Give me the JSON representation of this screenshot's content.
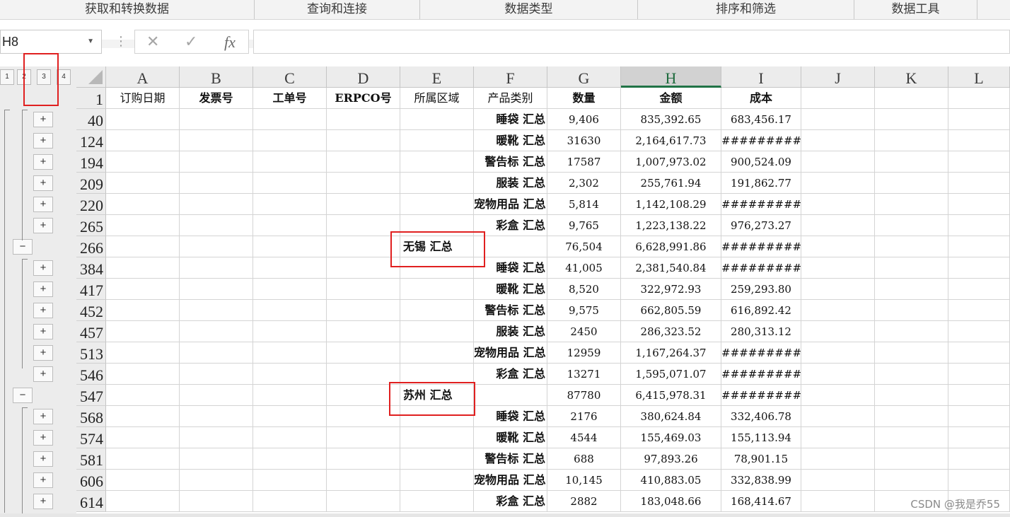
{
  "ribbon": {
    "groups": [
      "获取和转换数据",
      "查询和连接",
      "数据类型",
      "排序和筛选",
      "数据工具"
    ]
  },
  "formula_bar": {
    "name_box": "H8",
    "cancel_icon": "✕",
    "enter_icon": "✓",
    "fx_label": "fx",
    "formula": ""
  },
  "outline_levels": [
    "1",
    "2",
    "3",
    "4"
  ],
  "columns": [
    "A",
    "B",
    "C",
    "D",
    "E",
    "F",
    "G",
    "H",
    "I",
    "J",
    "K",
    "L"
  ],
  "header_row": {
    "row_number": "1",
    "cells": [
      "订购日期",
      "发票号",
      "工单号",
      "ERPCO号",
      "所属区域",
      "产品类别",
      "数量",
      "金额",
      "成本"
    ]
  },
  "rows": [
    {
      "row": "40",
      "E": "",
      "F": "睡袋 汇总",
      "G": "9,406",
      "H": "835,392.65",
      "I": "683,456.17"
    },
    {
      "row": "124",
      "E": "",
      "F": "暖靴 汇总",
      "G": "31630",
      "H": "2,164,617.73",
      "I": "###########"
    },
    {
      "row": "194",
      "E": "",
      "F": "警告标 汇总",
      "G": "17587",
      "H": "1,007,973.02",
      "I": "900,524.09"
    },
    {
      "row": "209",
      "E": "",
      "F": "服装 汇总",
      "G": "2,302",
      "H": "255,761.94",
      "I": "191,862.77"
    },
    {
      "row": "220",
      "E": "",
      "F": "宠物用品 汇总",
      "G": "5,814",
      "H": "1,142,108.29",
      "I": "###########"
    },
    {
      "row": "265",
      "E": "",
      "F": "彩盒 汇总",
      "G": "9,765",
      "H": "1,223,138.22",
      "I": "976,273.27"
    },
    {
      "row": "266",
      "E": "无锡 汇总",
      "F": "",
      "G": "76,504",
      "H": "6,628,991.86",
      "I": "###########"
    },
    {
      "row": "384",
      "E": "",
      "F": "睡袋 汇总",
      "G": "41,005",
      "H": "2,381,540.84",
      "I": "###########"
    },
    {
      "row": "417",
      "E": "",
      "F": "暖靴 汇总",
      "G": "8,520",
      "H": "322,972.93",
      "I": "259,293.80"
    },
    {
      "row": "452",
      "E": "",
      "F": "警告标 汇总",
      "G": "9,575",
      "H": "662,805.59",
      "I": "616,892.42"
    },
    {
      "row": "457",
      "E": "",
      "F": "服装 汇总",
      "G": "2450",
      "H": "286,323.52",
      "I": "280,313.12"
    },
    {
      "row": "513",
      "E": "",
      "F": "宠物用品 汇总",
      "G": "12959",
      "H": "1,167,264.37",
      "I": "###########"
    },
    {
      "row": "546",
      "E": "",
      "F": "彩盒 汇总",
      "G": "13271",
      "H": "1,595,071.07",
      "I": "###########"
    },
    {
      "row": "547",
      "E": "苏州 汇总",
      "F": "",
      "G": "87780",
      "H": "6,415,978.31",
      "I": "###########"
    },
    {
      "row": "568",
      "E": "",
      "F": "睡袋 汇总",
      "G": "2176",
      "H": "380,624.84",
      "I": "332,406.78"
    },
    {
      "row": "574",
      "E": "",
      "F": "暖靴 汇总",
      "G": "4544",
      "H": "155,469.03",
      "I": "155,113.94"
    },
    {
      "row": "581",
      "E": "",
      "F": "警告标 汇总",
      "G": "688",
      "H": "97,893.26",
      "I": "78,901.15"
    },
    {
      "row": "606",
      "E": "",
      "F": "宠物用品 汇总",
      "G": "10,145",
      "H": "410,883.05",
      "I": "332,838.99"
    },
    {
      "row": "614",
      "E": "",
      "F": "彩盒 汇总",
      "G": "2882",
      "H": "183,048.66",
      "I": "168,414.67"
    }
  ],
  "outline_buttons": {
    "expand_symbol": "+",
    "collapse_symbol": "−"
  },
  "watermark": "CSDN @我是乔55",
  "colors": {
    "accent_green": "#217346",
    "highlight_red": "#e02020"
  }
}
